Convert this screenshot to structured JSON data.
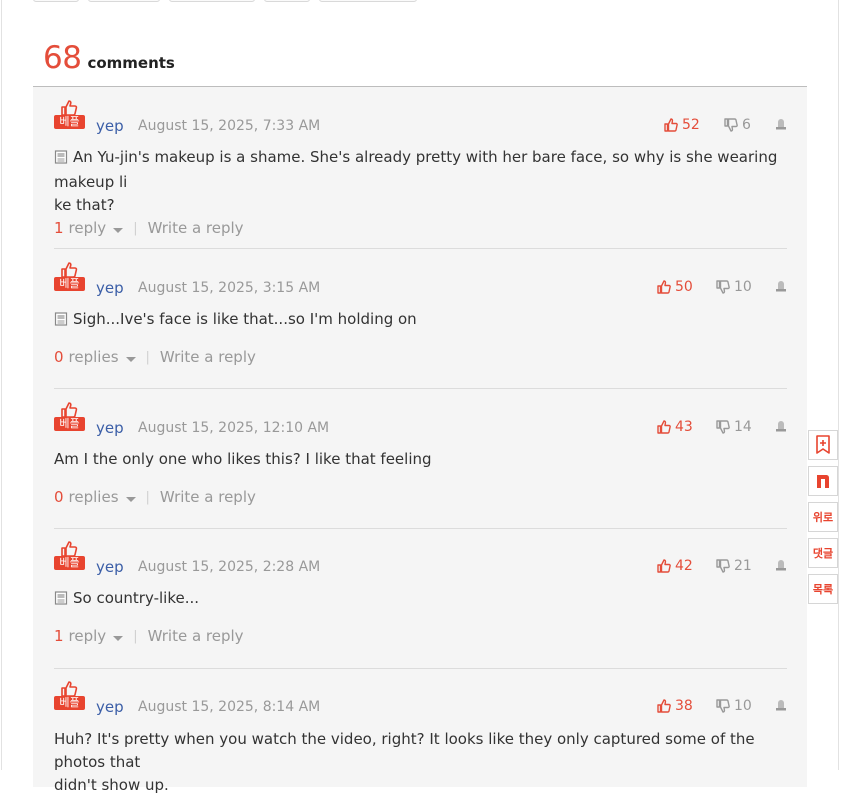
{
  "header": {
    "count": "68",
    "label": "comments"
  },
  "comments": [
    {
      "badge": "베플",
      "author": "yep",
      "date": "August 15, 2025, 7:33 AM",
      "likes": "52",
      "dislikes": "6",
      "text": "An Yu-jin's makeup is a shame. She's already pretty with her bare face, so why is she wearing makeup li",
      "text2": "ke that?",
      "reply_count": "1",
      "reply_word": "reply",
      "write_reply": "Write a reply"
    },
    {
      "badge": "베플",
      "author": "yep",
      "date": "August 15, 2025, 3:15 AM",
      "likes": "50",
      "dislikes": "10",
      "text": "Sigh...Ive's face is like that...so I'm holding on",
      "reply_count": "0",
      "reply_word": "replies",
      "write_reply": "Write a reply"
    },
    {
      "badge": "베플",
      "author": "yep",
      "date": "August 15, 2025, 12:10 AM",
      "likes": "43",
      "dislikes": "14",
      "text": "Am I the only one who likes this? I like that feeling",
      "reply_count": "0",
      "reply_word": "replies",
      "write_reply": "Write a reply"
    },
    {
      "badge": "베플",
      "author": "yep",
      "date": "August 15, 2025, 2:28 AM",
      "likes": "42",
      "dislikes": "21",
      "text": "So country-like...",
      "reply_count": "1",
      "reply_word": "reply",
      "write_reply": "Write a reply"
    },
    {
      "badge": "베플",
      "author": "yep",
      "date": "August 15, 2025, 8:14 AM",
      "likes": "38",
      "dislikes": "10",
      "text": "Huh? It's pretty when you watch the video, right? It looks like they only captured some of the photos that",
      "text2": "didn't show up."
    }
  ],
  "side_rail": {
    "top": "위로",
    "comments": "댓글",
    "list": "목록"
  },
  "colors": {
    "accent": "#e44d3a",
    "author": "#3b5ea7"
  }
}
